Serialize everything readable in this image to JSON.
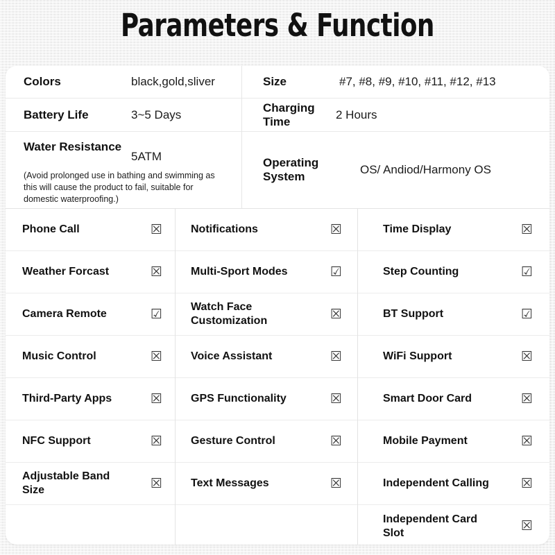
{
  "title": "Parameters & Function",
  "colors": {
    "page_background": "#f1f1f1",
    "card_background": "#ffffff",
    "text": "#111111",
    "divider": "#e9e9e9"
  },
  "spec_table": {
    "left_column": [
      {
        "label": "Colors",
        "value": "black,gold,sliver"
      },
      {
        "label": "Battery Life",
        "value": "3~5 Days"
      },
      {
        "label": "Water Resistance",
        "value": "5ATM",
        "note": "(Avoid prolonged use in bathing and swimming as this will cause the product to fail, suitable for domestic waterproofing.)"
      }
    ],
    "right_column": [
      {
        "label": "Size",
        "value": "#7, #8, #9, #10, #11, #12, #13"
      },
      {
        "label": "Charging Time",
        "value": "2 Hours"
      },
      {
        "label": "Operating System",
        "value": "OS/ Andiod/Harmony OS"
      }
    ]
  },
  "feature_grid": {
    "checked_glyph": "☑",
    "unchecked_glyph": "☒",
    "column_1": [
      {
        "label": "Phone Call",
        "state": "☒"
      },
      {
        "label": "Weather Forcast",
        "state": "☒"
      },
      {
        "label": "Camera Remote",
        "state": "☑"
      },
      {
        "label": "Music Control",
        "state": "☒"
      },
      {
        "label": "Third-Party Apps",
        "state": "☒"
      },
      {
        "label": "NFC Support",
        "state": "☒"
      },
      {
        "label": "Adjustable Band Size",
        "state": "☒"
      }
    ],
    "column_2": [
      {
        "label": "Notifications",
        "state": "☒"
      },
      {
        "label": "Multi-Sport Modes",
        "state": "☑"
      },
      {
        "label": "Watch Face Customization",
        "state": "☒"
      },
      {
        "label": "Voice Assistant",
        "state": "☒"
      },
      {
        "label": "GPS Functionality",
        "state": "☒"
      },
      {
        "label": "Gesture Control",
        "state": "☒"
      },
      {
        "label": "Text Messages",
        "state": "☒"
      }
    ],
    "column_3": [
      {
        "label": "Time Display",
        "state": "☒"
      },
      {
        "label": "Step Counting",
        "state": "☑"
      },
      {
        "label": "BT Support",
        "state": "☑"
      },
      {
        "label": "WiFi Support",
        "state": "☒"
      },
      {
        "label": "Smart Door Card",
        "state": "☒"
      },
      {
        "label": "Mobile Payment",
        "state": "☒"
      },
      {
        "label": "Independent Calling",
        "state": "☒"
      },
      {
        "label": "Independent Card Slot",
        "state": "☒"
      }
    ]
  }
}
